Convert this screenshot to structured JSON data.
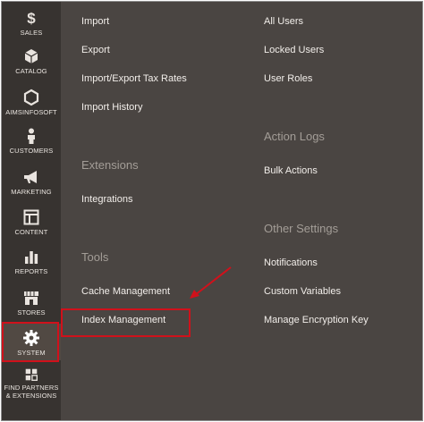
{
  "sidebar": {
    "items": [
      {
        "label": "SALES",
        "icon": "dollar-icon"
      },
      {
        "label": "CATALOG",
        "icon": "cube-icon"
      },
      {
        "label": "AIMSINFOSOFT",
        "icon": "hexagon-icon"
      },
      {
        "label": "CUSTOMERS",
        "icon": "person-icon"
      },
      {
        "label": "MARKETING",
        "icon": "megaphone-icon"
      },
      {
        "label": "CONTENT",
        "icon": "layout-icon"
      },
      {
        "label": "REPORTS",
        "icon": "bar-chart-icon"
      },
      {
        "label": "STORES",
        "icon": "storefront-icon"
      },
      {
        "label": "SYSTEM",
        "icon": "gear-icon",
        "active": true
      },
      {
        "label_line1": "FIND PARTNERS",
        "label_line2": "& EXTENSIONS",
        "icon": "blocks-icon"
      }
    ]
  },
  "menu": {
    "left": {
      "links_top": [
        "Import",
        "Export",
        "Import/Export Tax Rates",
        "Import History"
      ],
      "extensions_heading": "Extensions",
      "extensions_links": [
        "Integrations"
      ],
      "tools_heading": "Tools",
      "tools_links": [
        "Cache Management",
        "Index Management"
      ]
    },
    "right": {
      "links_top": [
        "All Users",
        "Locked Users",
        "User Roles"
      ],
      "action_logs_heading": "Action Logs",
      "action_logs_links": [
        "Bulk Actions"
      ],
      "other_settings_heading": "Other Settings",
      "other_settings_links": [
        "Notifications",
        "Custom Variables",
        "Manage Encryption Key"
      ]
    }
  },
  "colors": {
    "sidebar_bg": "#373330",
    "panel_bg": "#4a4542",
    "highlight": "#d0111b"
  }
}
